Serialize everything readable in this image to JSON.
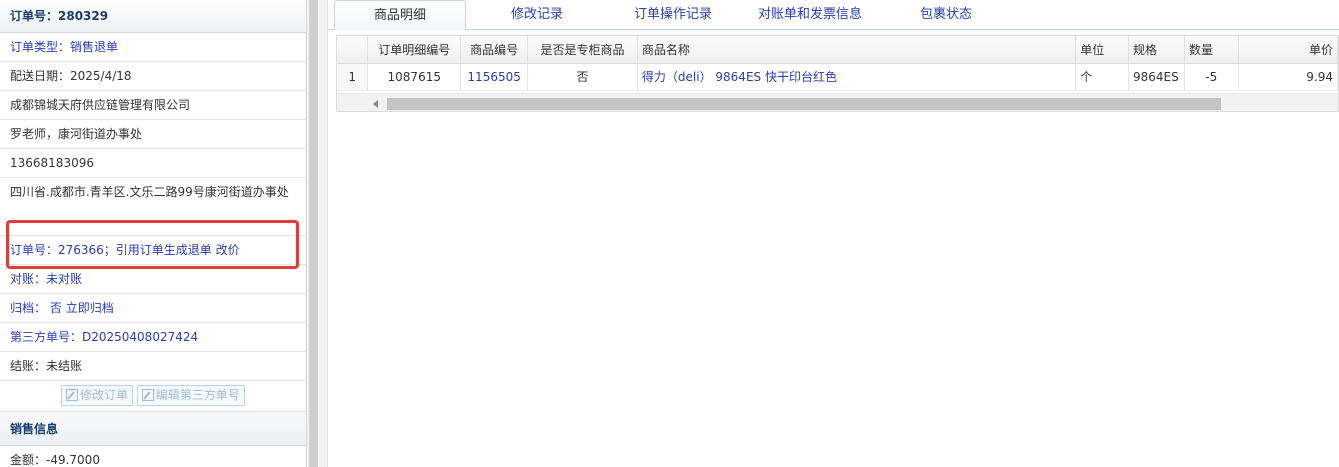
{
  "order": {
    "header": "订单号：280329",
    "type_label": "订单类型：",
    "type_value": "销售退单",
    "delivery_date": "配送日期：2025/4/18",
    "company": "成都锦城天府供应链管理有限公司",
    "contact": "罗老师，康河街道办事处",
    "phone": "13668183096",
    "address": "四川省.成都市.青羊区.文乐二路99号康河街道办事处",
    "ref_order_label": "订单号：276366；引用订单生成退单",
    "ref_order_action": "改价",
    "reconcile_label": "对账：",
    "reconcile_value": "未对账",
    "archive_label": "归档：",
    "archive_value": "否",
    "archive_action": "立即归档",
    "third_party": "第三方单号：D20250408027424",
    "settle": "结账：未结账",
    "btn_edit_order": "修改订单",
    "btn_edit_third": "编辑第三方单号"
  },
  "sales": {
    "title": "销售信息",
    "amount": "金额：-49.7000"
  },
  "tabs": [
    "商品明细",
    "修改记录",
    "订单操作记录",
    "对账单和发票信息",
    "包裹状态"
  ],
  "grid": {
    "columns": [
      "订单明细编号",
      "商品编号",
      "是否是专柜商品",
      "商品名称",
      "单位",
      "规格",
      "数量",
      "单价"
    ],
    "rows": [
      {
        "index": "1",
        "detail_id": "1087615",
        "product_id": "1156505",
        "is_counter": "否",
        "name": "得力（deli） 9864ES 快干印台红色",
        "unit": "个",
        "spec": "9864ES",
        "qty": "-5",
        "price": "9.94"
      }
    ]
  },
  "colors": {
    "link": "#2a3db3",
    "highlight": "#e23b3b"
  }
}
